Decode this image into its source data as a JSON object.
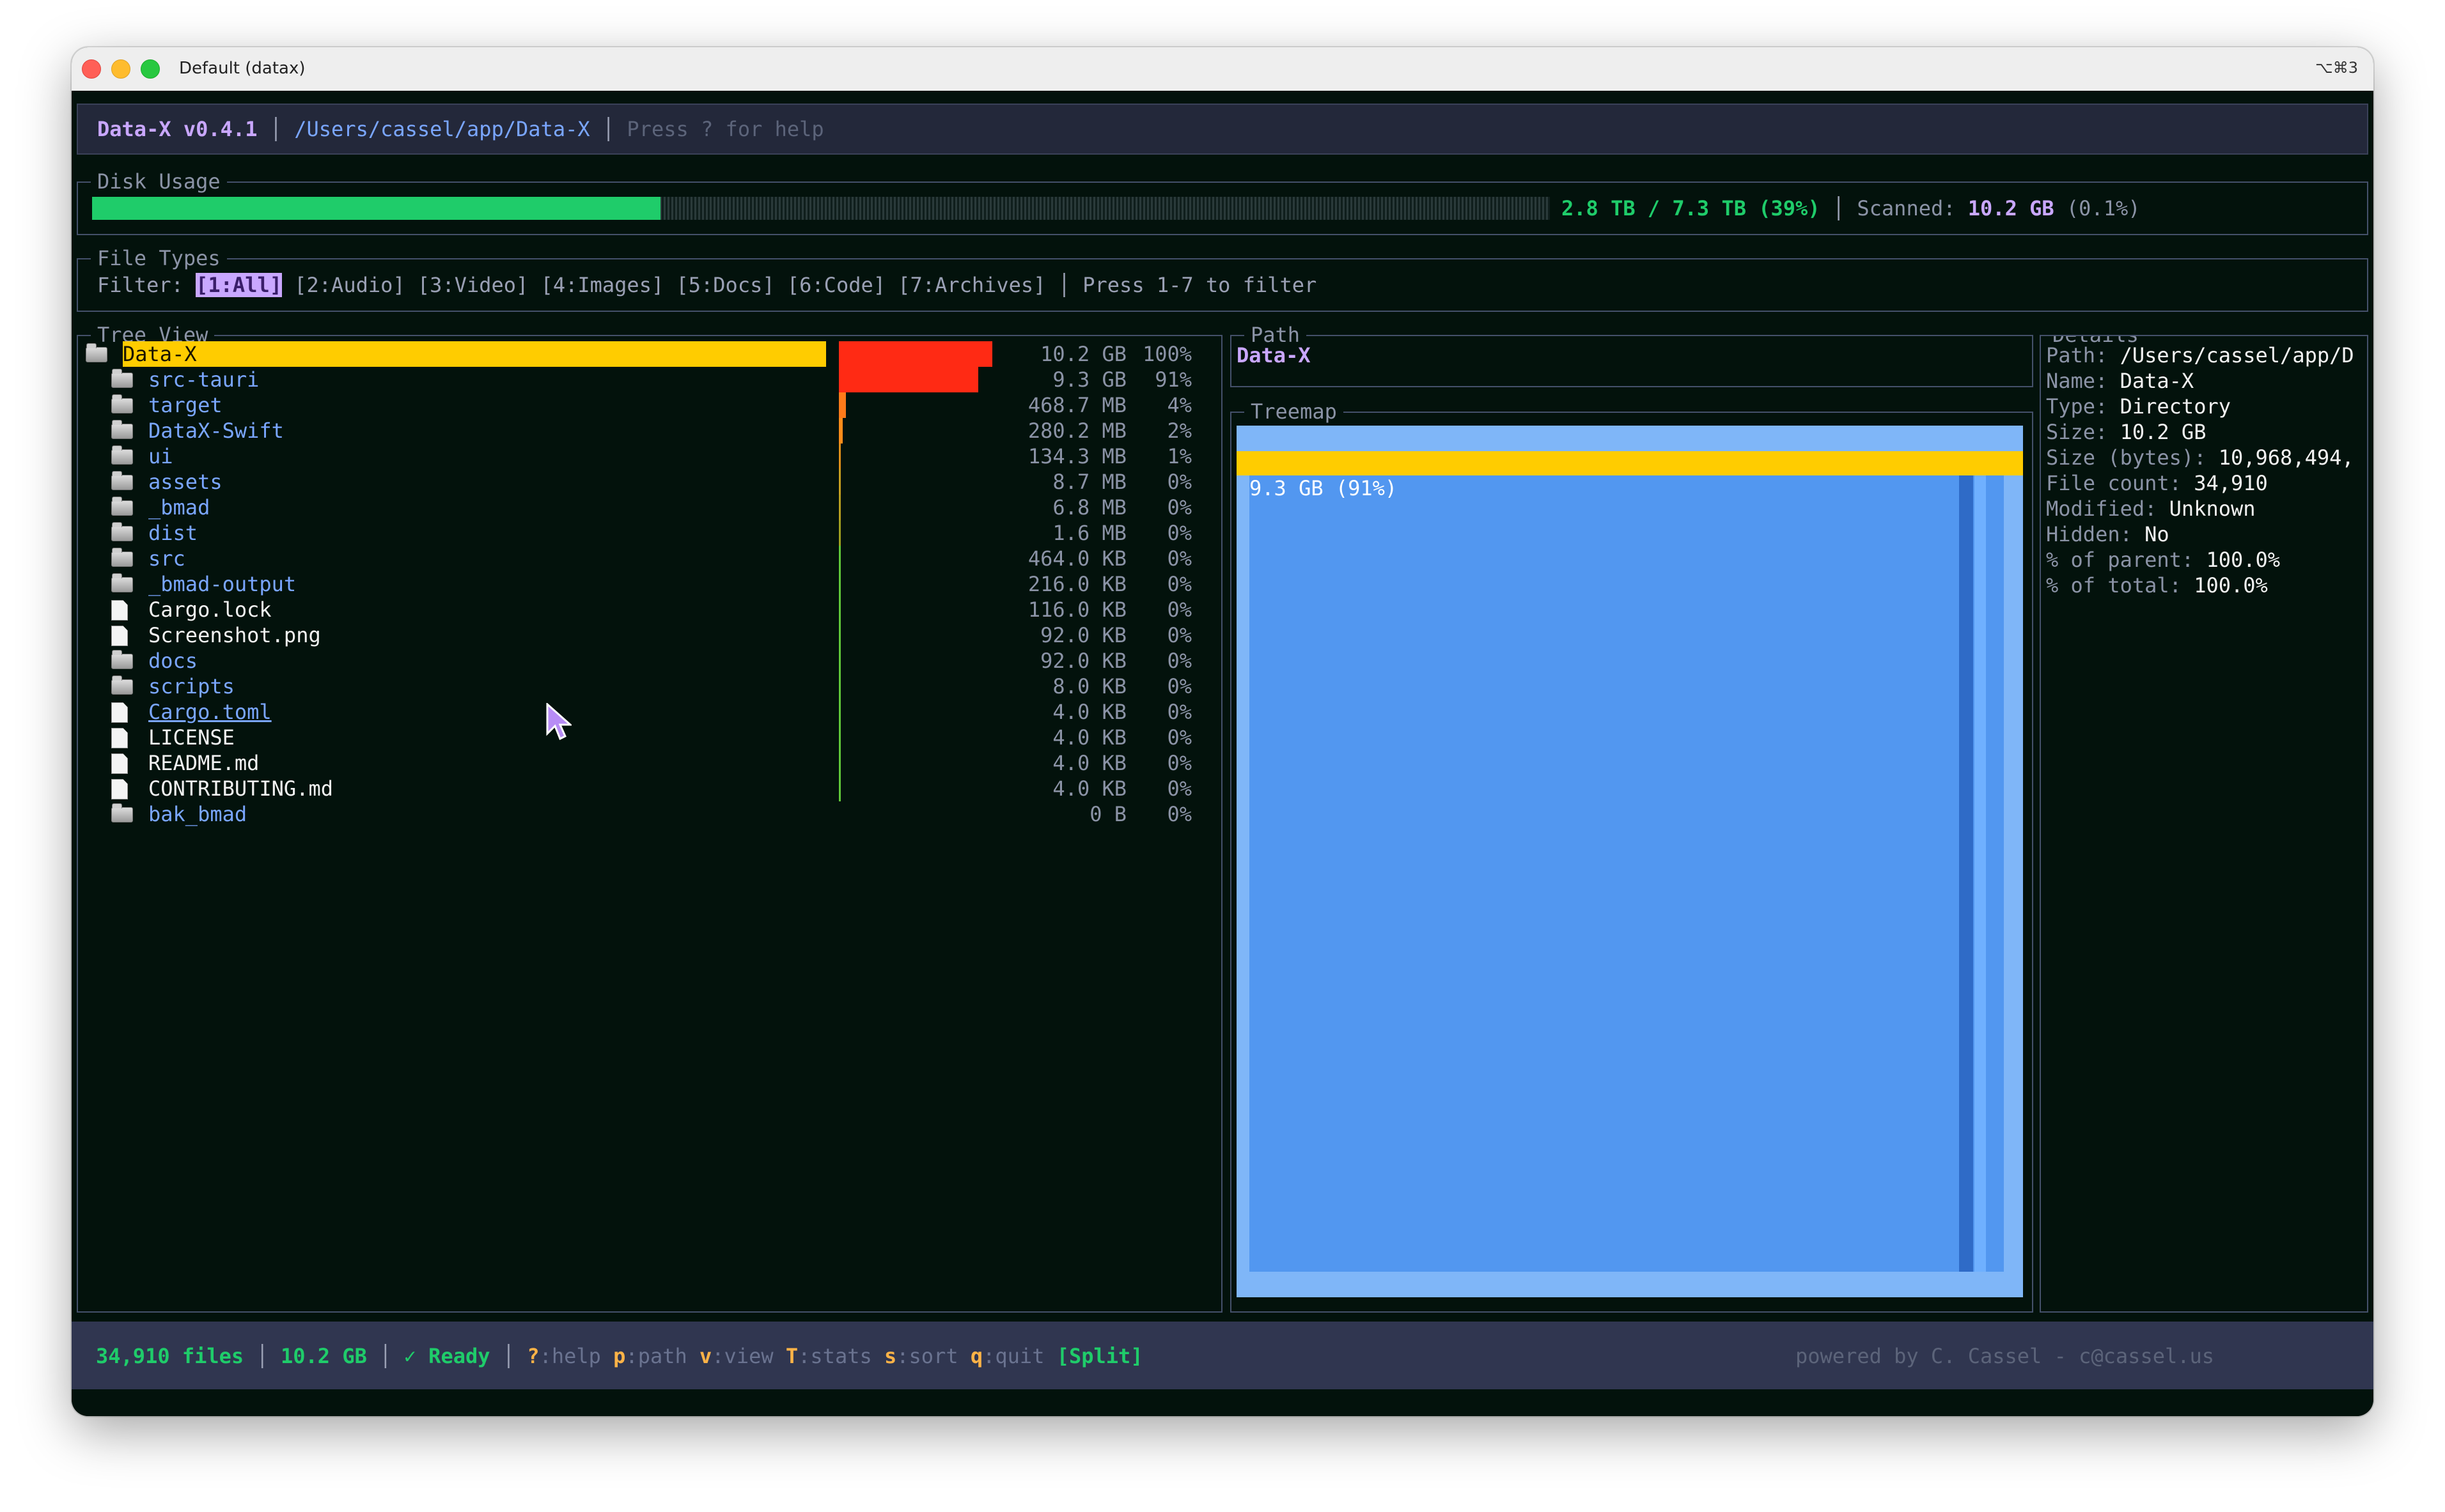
{
  "window": {
    "title": "Default (datax)",
    "shortcut": "⌥⌘3"
  },
  "header": {
    "app": "Data-X v0.4.1",
    "sep": "│",
    "path": "/Users/cassel/app/Data-X",
    "hint": "Press ? for help"
  },
  "disk_usage": {
    "title": "Disk Usage",
    "used_fraction": 0.39,
    "summary": "2.8 TB / 7.3 TB (39%)",
    "sep": "│",
    "scanned_label": "Scanned:",
    "scanned_value": "10.2 GB",
    "scanned_pct": "(0.1%)"
  },
  "file_types": {
    "title": "File Types",
    "filter_label": "Filter:",
    "filters": [
      "[1:All]",
      "[2:Audio]",
      "[3:Video]",
      "[4:Images]",
      "[5:Docs]",
      "[6:Code]",
      "[7:Archives]"
    ],
    "sep": "│",
    "hint": "Press 1-7 to filter"
  },
  "tree": {
    "title": "Tree View",
    "rows": [
      {
        "name": "Data-X",
        "type": "folder",
        "size": "10.2 GB",
        "pct": "100%",
        "fraction": 1.0,
        "bar_color": "#ff2a14",
        "selected": true
      },
      {
        "name": "src-tauri",
        "type": "folder",
        "size": "9.3 GB",
        "pct": "91%",
        "fraction": 0.91,
        "bar_color": "#ff2a14"
      },
      {
        "name": "target",
        "type": "folder",
        "size": "468.7 MB",
        "pct": "4%",
        "fraction": 0.045,
        "bar_color": "#ff7a1a"
      },
      {
        "name": "DataX-Swift",
        "type": "folder",
        "size": "280.2 MB",
        "pct": "2%",
        "fraction": 0.027,
        "bar_color": "#ff8c1a"
      },
      {
        "name": "ui",
        "type": "folder",
        "size": "134.3 MB",
        "pct": "1%",
        "fraction": 0.013,
        "bar_color": "#e0901a"
      },
      {
        "name": "assets",
        "type": "folder",
        "size": "8.7 MB",
        "pct": "0%",
        "fraction": 0.001,
        "bar_color": "#c8a020"
      },
      {
        "name": "_bmad",
        "type": "folder",
        "size": "6.8 MB",
        "pct": "0%",
        "fraction": 0.001,
        "bar_color": "#b8a020"
      },
      {
        "name": "dist",
        "type": "folder",
        "size": "1.6 MB",
        "pct": "0%",
        "fraction": 0.001,
        "bar_color": "#a0a020"
      },
      {
        "name": "src",
        "type": "folder",
        "size": "464.0 KB",
        "pct": "0%",
        "fraction": 0.0005,
        "bar_color": "#5fc83a"
      },
      {
        "name": "_bmad-output",
        "type": "folder",
        "size": "216.0 KB",
        "pct": "0%",
        "fraction": 0.0005,
        "bar_color": "#5fc83a"
      },
      {
        "name": "Cargo.lock",
        "type": "file",
        "size": "116.0 KB",
        "pct": "0%",
        "fraction": 0.0005,
        "bar_color": "#5fc83a"
      },
      {
        "name": "Screenshot.png",
        "type": "file",
        "size": "92.0 KB",
        "pct": "0%",
        "fraction": 0.0005,
        "bar_color": "#5fc83a"
      },
      {
        "name": "docs",
        "type": "folder",
        "size": "92.0 KB",
        "pct": "0%",
        "fraction": 0.0005,
        "bar_color": "#5fc83a"
      },
      {
        "name": "scripts",
        "type": "folder",
        "size": "8.0 KB",
        "pct": "0%",
        "fraction": 0.0005,
        "bar_color": "#5fc83a"
      },
      {
        "name": "Cargo.toml",
        "type": "file",
        "size": "4.0 KB",
        "pct": "0%",
        "fraction": 0.0005,
        "bar_color": "#5fc83a",
        "link": true
      },
      {
        "name": "LICENSE",
        "type": "file",
        "size": "4.0 KB",
        "pct": "0%",
        "fraction": 0.0005,
        "bar_color": "#5fc83a"
      },
      {
        "name": "README.md",
        "type": "file",
        "size": "4.0 KB",
        "pct": "0%",
        "fraction": 0.0005,
        "bar_color": "#5fc83a"
      },
      {
        "name": "CONTRIBUTING.md",
        "type": "file",
        "size": "4.0 KB",
        "pct": "0%",
        "fraction": 0.0005,
        "bar_color": "#5fc83a"
      },
      {
        "name": "bak_bmad",
        "type": "folder",
        "size": "0 B",
        "pct": "0%",
        "fraction": 0,
        "bar_color": null
      }
    ]
  },
  "path_panel": {
    "title": "Path",
    "value": "Data-X"
  },
  "treemap": {
    "title": "Treemap",
    "label": "9.3 GB (91%)"
  },
  "details": {
    "title": "Details",
    "rows": [
      {
        "label": "Path:",
        "value": "/Users/cassel/app/D"
      },
      {
        "label": "Name:",
        "value": "Data-X"
      },
      {
        "label": "Type:",
        "value": "Directory"
      },
      {
        "label": "Size:",
        "value": "10.2 GB"
      },
      {
        "label": "Size (bytes):",
        "value": "10,968,494,"
      },
      {
        "label": "File count:",
        "value": "34,910"
      },
      {
        "label": "Modified:",
        "value": "Unknown"
      },
      {
        "label": "Hidden:",
        "value": "No"
      },
      {
        "label": "% of parent:",
        "value": "100.0%"
      },
      {
        "label": "% of total:",
        "value": "100.0%"
      }
    ]
  },
  "footer": {
    "files": "34,910 files",
    "size": "10.2 GB",
    "status": "✓ Ready",
    "sep": "│",
    "keys": [
      {
        "key": "?",
        "action": ":help"
      },
      {
        "key": "p",
        "action": ":path"
      },
      {
        "key": "v",
        "action": ":view"
      },
      {
        "key": "T",
        "action": ":stats"
      },
      {
        "key": "s",
        "action": ":sort"
      },
      {
        "key": "q",
        "action": ":quit"
      }
    ],
    "mode": "[Split]",
    "credit": "powered by C. Cassel - c@cassel.us"
  },
  "colors": {
    "accent_purple": "#c9a7ff",
    "green": "#1fcc6a",
    "folder_blue": "#7aa6ff",
    "selection_yellow": "#ffcc00",
    "treemap_blue": "#5297f0"
  }
}
